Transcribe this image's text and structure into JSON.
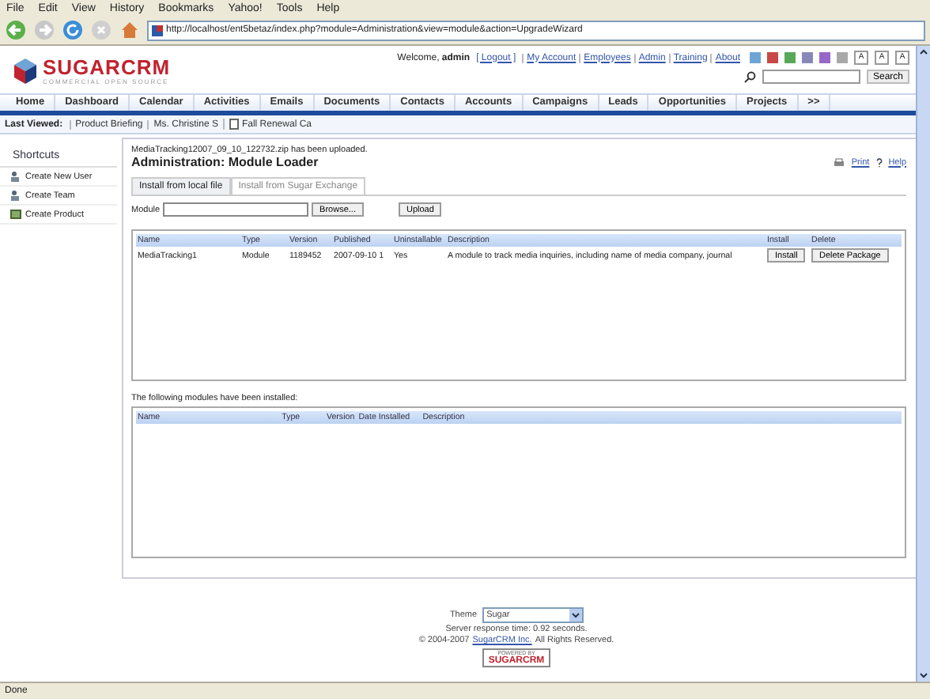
{
  "browser_menu": [
    "File",
    "Edit",
    "View",
    "History",
    "Bookmarks",
    "Yahoo!",
    "Tools",
    "Help"
  ],
  "address_bar": {
    "value": "http://localhost/ent5betaz/index.php?module=Administration&view=module&action=UpgradeWizard"
  },
  "logo": {
    "brand": "SUGARCRM",
    "tagline": "COMMERCIAL OPEN SOURCE"
  },
  "welcome": {
    "prefix": "Welcome,",
    "user": "admin",
    "logout": "[ Logout ]"
  },
  "top_links": [
    "My Account",
    "Employees",
    "Admin",
    "Training",
    "About"
  ],
  "theme_swatches": [
    {
      "color": "#6fa5d6"
    },
    {
      "color": "#c84848"
    },
    {
      "color": "#58a858"
    },
    {
      "color": "#8888b8"
    },
    {
      "color": "#9868c8"
    },
    {
      "color": "#a8a8a8"
    }
  ],
  "font_sizes": [
    "A",
    "A",
    "A"
  ],
  "search": {
    "button": "Search"
  },
  "tabs": [
    {
      "label": "Home",
      "selected": false
    },
    {
      "label": "Dashboard",
      "selected": false
    },
    {
      "label": "Calendar",
      "selected": false
    },
    {
      "label": "Activities",
      "selected": false
    },
    {
      "label": "Emails",
      "selected": false
    },
    {
      "label": "Documents",
      "selected": false
    },
    {
      "label": "Contacts",
      "selected": false
    },
    {
      "label": "Accounts",
      "selected": false
    },
    {
      "label": "Campaigns",
      "selected": false
    },
    {
      "label": "Leads",
      "selected": false
    },
    {
      "label": "Opportunities",
      "selected": false
    },
    {
      "label": "Projects",
      "selected": false
    },
    {
      "label": ">>",
      "selected": false
    }
  ],
  "last_viewed": {
    "label": "Last Viewed:",
    "items": [
      {
        "label": "Product Briefing",
        "kind": "plain"
      },
      {
        "label": "Ms. Christine S",
        "kind": "plain"
      },
      {
        "label": "Fall Renewal Ca",
        "kind": "document"
      }
    ]
  },
  "shortcuts": {
    "title": "Shortcuts",
    "items": [
      "Create New User",
      "Create Team",
      "Create Product"
    ]
  },
  "upload_message": "MediaTracking12007_09_10_122732.zip has been uploaded.",
  "page_title": "Administration: Module Loader",
  "print": "Print",
  "help": "Help",
  "install_tabs": [
    {
      "label": "Install from local file",
      "selected": true
    },
    {
      "label": "Install from Sugar Exchange",
      "selected": false
    }
  ],
  "module_field": {
    "label": "Module",
    "browse": "Browse...",
    "upload": "Upload"
  },
  "uploaded_table": {
    "columns": [
      "Name",
      "Type",
      "Version",
      "Published",
      "Uninstallable",
      "Description",
      "Install",
      "Delete"
    ],
    "rows": [
      {
        "name": "MediaTracking1",
        "type": "Module",
        "version": "1189452",
        "published": "2007-09-10 1",
        "uninstallable": "Yes",
        "description": "A module to track media inquiries, including name of media company, journal",
        "install": "Install",
        "delete": "Delete Package"
      }
    ]
  },
  "installed_label": "The following modules have been installed:",
  "installed_table": {
    "columns": [
      "Name",
      "Type",
      "Version",
      "Date Installed",
      "Description"
    ]
  },
  "footer": {
    "theme_label": "Theme",
    "theme_value": "Sugar",
    "response": "Server response time: 0.92 seconds.",
    "copyright": "© 2004-2007",
    "company_link": "SugarCRM Inc.",
    "rights": "All Rights Reserved.",
    "powered_top": "POWERED BY",
    "powered_brand": "SUGARCRM"
  },
  "status_bar": "Done"
}
